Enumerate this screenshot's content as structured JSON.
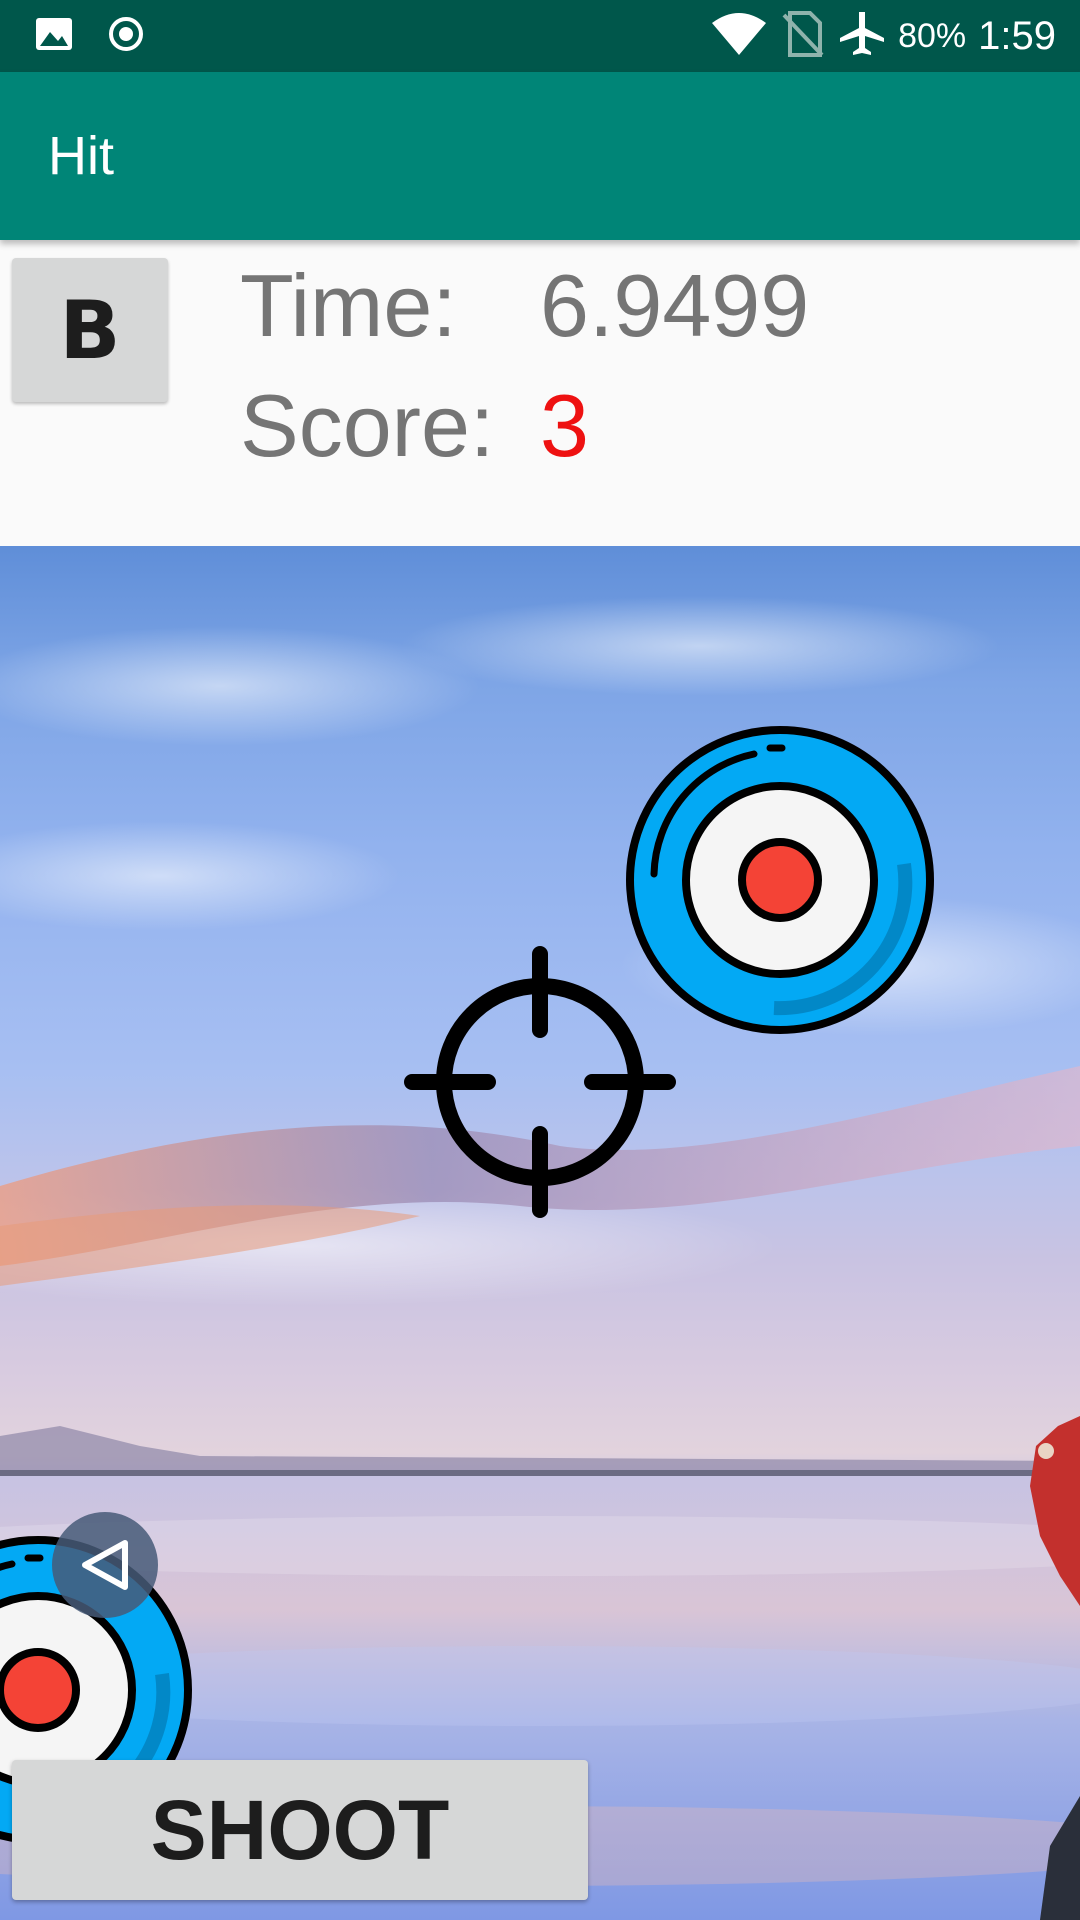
{
  "status_bar": {
    "battery": "80%",
    "clock": "1:59",
    "icons": [
      "image-icon",
      "record-icon",
      "wifi-icon",
      "no-sim-icon",
      "airplane-icon"
    ]
  },
  "app_bar": {
    "title": "Hit"
  },
  "hud": {
    "mode_button_label": "B",
    "time_label": "Time:",
    "time_value": "6.9499",
    "score_label": "Score:",
    "score_value": "3"
  },
  "controls": {
    "shoot_label": "SHOOT",
    "back_icon": "back-triangle-icon"
  },
  "colors": {
    "status_bar": "#00574b",
    "app_bar": "#008577",
    "score_value": "#ee1111",
    "target_ring": "#03a9f4",
    "target_center": "#f44336"
  }
}
